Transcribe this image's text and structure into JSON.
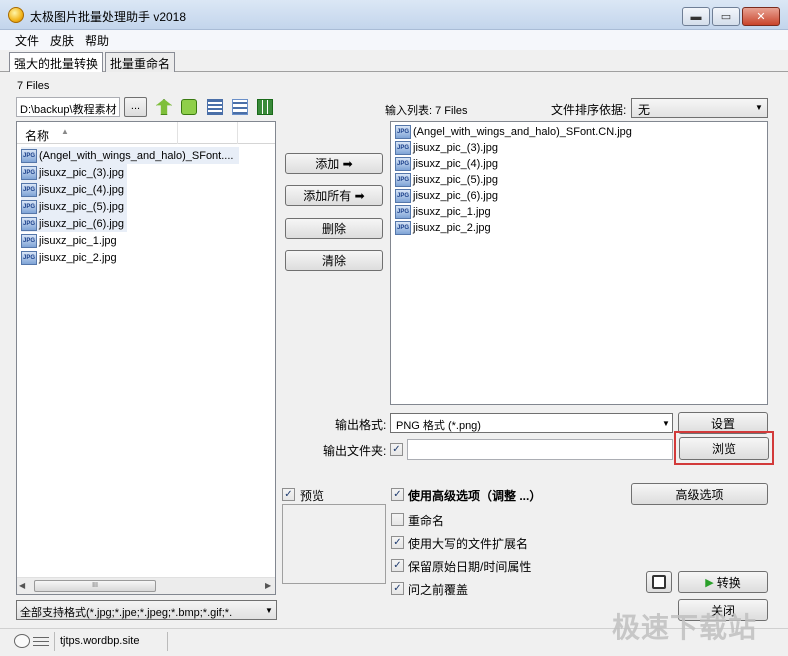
{
  "window": {
    "title": "太极图片批量处理助手  v2018",
    "minimize_glyph": "▬",
    "maximize_glyph": "▭",
    "close_glyph": "✕"
  },
  "menu": [
    "文件",
    "皮肤",
    "帮助"
  ],
  "tabs": [
    {
      "label": "强大的批量转换",
      "active": true
    },
    {
      "label": "批量重命名",
      "active": false
    }
  ],
  "browser": {
    "file_count": "7 Files",
    "path": "D:\\backup\\教程素材",
    "browse_label": "...",
    "column_name": "名称",
    "sort_glyph": "▲",
    "files": [
      "(Angel_with_wings_and_halo)_SFont....",
      "jisuxz_pic_(3).jpg",
      "jisuxz_pic_(4).jpg",
      "jisuxz_pic_(5).jpg",
      "jisuxz_pic_(6).jpg",
      "jisuxz_pic_1.jpg",
      "jisuxz_pic_2.jpg"
    ],
    "file_icon_text": "JPG",
    "scroll_left": "◀",
    "scroll_right": "▶",
    "scroll_thumb": "III",
    "filter": "全部支持格式(*.jpg;*.jpe;*.jpeg;*.bmp;*.gif;*."
  },
  "actions": {
    "add": "添加 ➡",
    "add_all": "添加所有 ➡",
    "delete": "删除",
    "clear": "清除"
  },
  "input_list": {
    "label": "输入列表: 7 Files",
    "sort_label": "文件排序依据:",
    "sort_value": "无",
    "files": [
      "(Angel_with_wings_and_halo)_SFont.CN.jpg",
      "jisuxz_pic_(3).jpg",
      "jisuxz_pic_(4).jpg",
      "jisuxz_pic_(5).jpg",
      "jisuxz_pic_(6).jpg",
      "jisuxz_pic_1.jpg",
      "jisuxz_pic_2.jpg"
    ]
  },
  "output": {
    "format_label": "输出格式:",
    "format_value": "PNG 格式  (*.png)",
    "settings_label": "设置",
    "folder_label": "输出文件夹:",
    "folder_checked": true,
    "folder_value": "",
    "browse_label": "浏览"
  },
  "preview": {
    "label": "预览",
    "checked": true
  },
  "options": [
    {
      "label": "使用高级选项（调整 ...）",
      "checked": true
    },
    {
      "label": "重命名",
      "checked": false
    },
    {
      "label": "使用大写的文件扩展名",
      "checked": true
    },
    {
      "label": "保留原始日期/时间属性",
      "checked": true
    },
    {
      "label": "问之前覆盖",
      "checked": true
    }
  ],
  "buttons": {
    "advanced": "高级选项",
    "convert": "转换",
    "convert_glyph": "▶",
    "close": "关闭"
  },
  "status": {
    "text": "tjtps.wordbp.site"
  },
  "watermark": "极速下载站",
  "check_glyph": "✓",
  "dropdown_glyph": "▼"
}
